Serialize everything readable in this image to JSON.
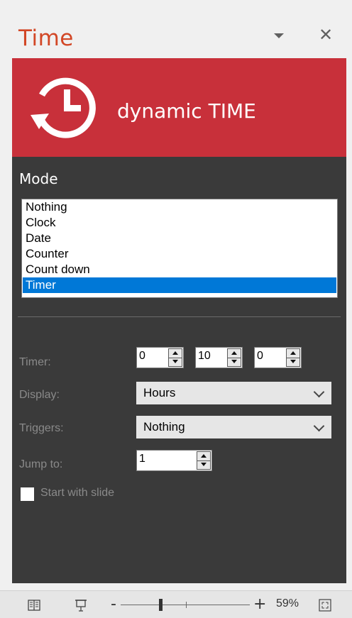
{
  "pane": {
    "title": "Time",
    "menu_icon": "chevron-down-icon",
    "close_glyph": "✕"
  },
  "banner": {
    "logo_icon": "clock-refresh-icon",
    "text": "dynamic TIME",
    "color": "#c8303a"
  },
  "mode": {
    "label": "Mode",
    "options": [
      "Nothing",
      "Clock",
      "Date",
      "Counter",
      "Count down",
      "Timer"
    ],
    "selected": "Timer"
  },
  "fields": {
    "timer_label": "Timer:",
    "timer_hours": "0",
    "timer_minutes": "10",
    "timer_seconds": "0",
    "display_label": "Display:",
    "display_value": "Hours",
    "triggers_label": "Triggers:",
    "triggers_value": "Nothing",
    "jump_label": "Jump to:",
    "jump_value": "1",
    "start_label": "Start with slide",
    "start_checked": false
  },
  "status_bar": {
    "reading_view_icon": "book-icon",
    "slideshow_icon": "slideshow-icon",
    "zoom_minus": "-",
    "zoom_plus": "+",
    "zoom_level": "59%",
    "zoom_fraction": 0.59,
    "fit_icon": "fit-to-window-icon"
  },
  "colors": {
    "accent": "#d24726",
    "panel_dark": "#3a3a3a",
    "selection": "#0078d7"
  }
}
